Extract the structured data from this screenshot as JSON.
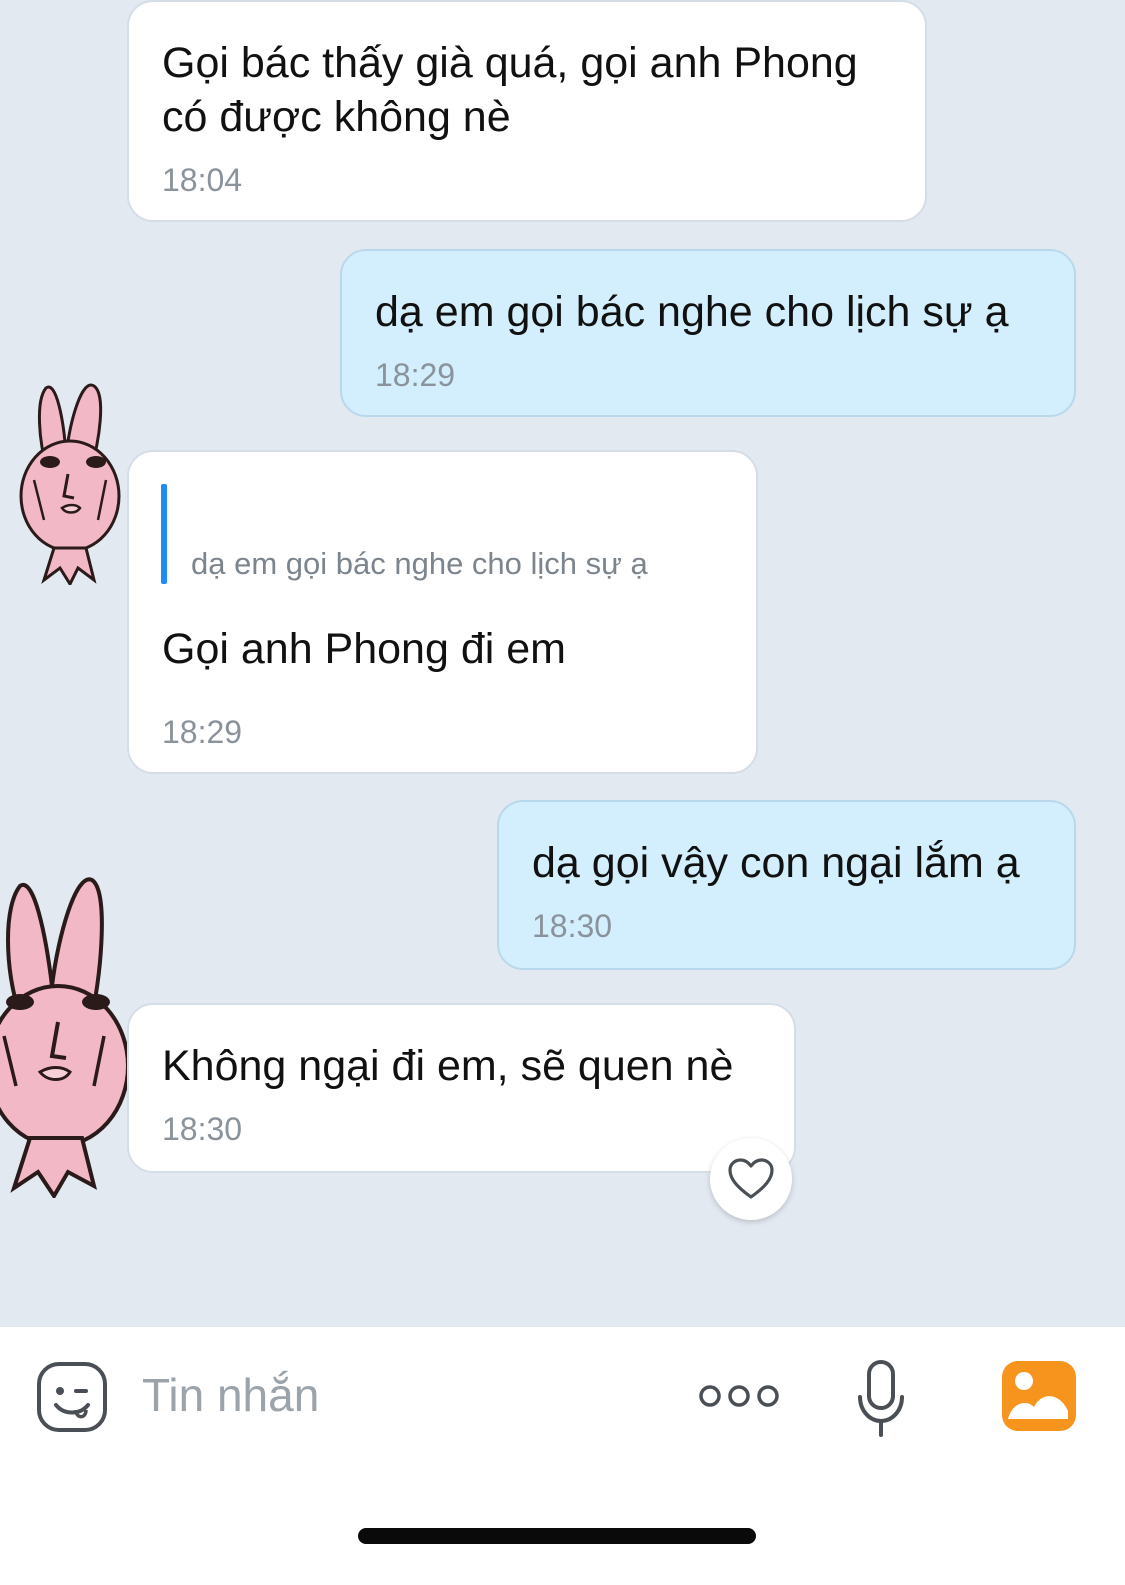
{
  "messages": [
    {
      "direction": "in",
      "text": "Gọi bác thấy già quá, gọi anh Phong\ncó được không nè",
      "time": "18:04"
    },
    {
      "direction": "out",
      "text": "dạ em gọi bác nghe cho lịch sự ạ",
      "time": "18:29"
    },
    {
      "direction": "in",
      "quote": "dạ em gọi bác nghe cho lịch sự ạ",
      "text": "Gọi anh Phong đi em",
      "time": "18:29"
    },
    {
      "direction": "out",
      "text": "dạ gọi vậy con ngại lắm ạ",
      "time": "18:30"
    },
    {
      "direction": "in",
      "text": "Không ngại đi em, sẽ quen nè",
      "time": "18:30"
    }
  ],
  "input": {
    "placeholder": "Tin nhắn"
  },
  "icons": {
    "sticker": "sticker-face-icon",
    "more": "more-dots-icon",
    "mic": "microphone-icon",
    "gallery": "image-gallery-icon",
    "reaction": "heart-icon"
  },
  "colors": {
    "chat_background": "#e3e9f1",
    "incoming_bubble": "#ffffff",
    "outgoing_bubble": "#d3eefc",
    "quote_accent": "#1f8ef1",
    "gallery_icon": "#f7941d",
    "avatar_pink": "#f2b8c6"
  }
}
